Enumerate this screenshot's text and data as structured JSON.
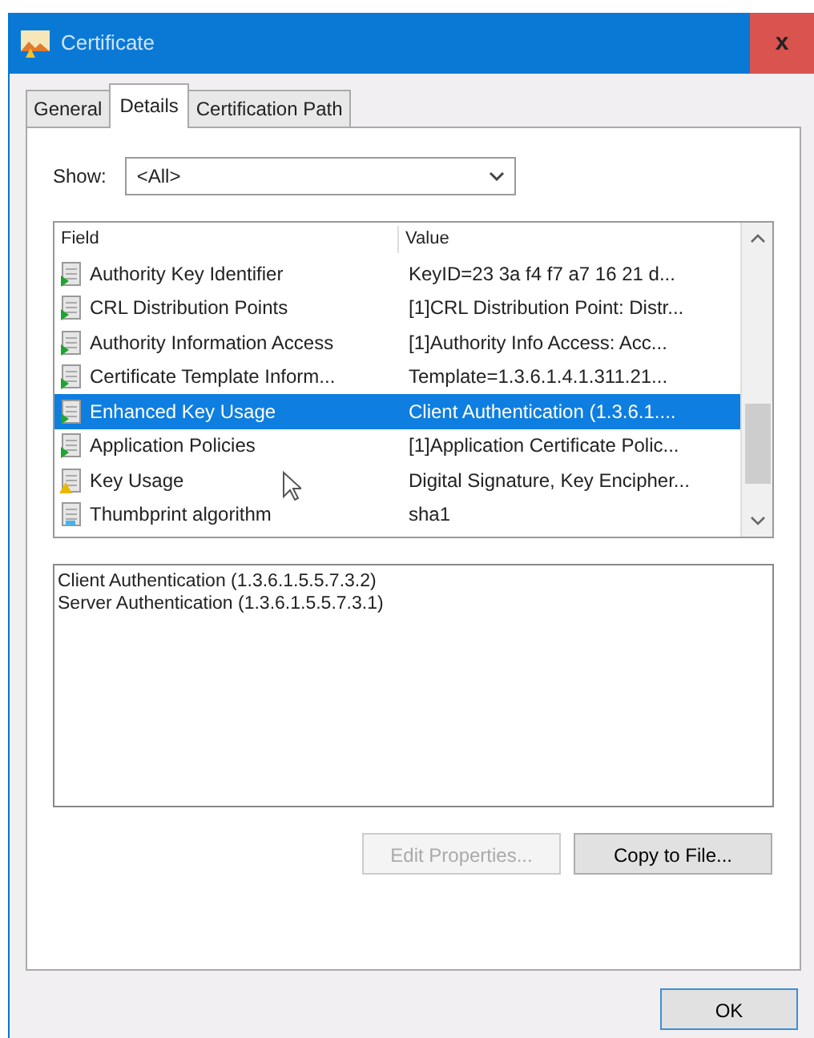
{
  "window": {
    "title": "Certificate",
    "close": "x"
  },
  "tabs": [
    {
      "label": "General",
      "selected": false
    },
    {
      "label": "Details",
      "selected": true
    },
    {
      "label": "Certification Path",
      "selected": false
    }
  ],
  "show": {
    "label": "Show:",
    "value": "<All>"
  },
  "table": {
    "columns": [
      "Field",
      "Value"
    ],
    "rows": [
      {
        "kind": "extension",
        "field": "Authority Key Identifier",
        "value": "KeyID=23 3a f4 f7 a7 16 21 d...",
        "selected": false
      },
      {
        "kind": "extension",
        "field": "CRL Distribution Points",
        "value": "[1]CRL Distribution Point: Distr...",
        "selected": false
      },
      {
        "kind": "extension",
        "field": "Authority Information Access",
        "value": "[1]Authority Info Access: Acc...",
        "selected": false
      },
      {
        "kind": "extension",
        "field": "Certificate Template Inform...",
        "value": "Template=1.3.6.1.4.1.311.21...",
        "selected": false
      },
      {
        "kind": "extension",
        "field": "Enhanced Key Usage",
        "value": "Client Authentication (1.3.6.1....",
        "selected": true
      },
      {
        "kind": "extension",
        "field": "Application Policies",
        "value": "[1]Application Certificate Polic...",
        "selected": false
      },
      {
        "kind": "critical",
        "field": "Key Usage",
        "value": "Digital Signature, Key Encipher...",
        "selected": false
      },
      {
        "kind": "property",
        "field": "Thumbprint algorithm",
        "value": "sha1",
        "selected": false
      }
    ]
  },
  "detail": [
    "Client Authentication (1.3.6.1.5.5.7.3.2)",
    "Server Authentication (1.3.6.1.5.5.7.3.1)"
  ],
  "buttons": [
    {
      "label": "Edit Properties...",
      "disabled": true
    },
    {
      "label": "Copy to File...",
      "disabled": false
    }
  ],
  "ok": "OK"
}
